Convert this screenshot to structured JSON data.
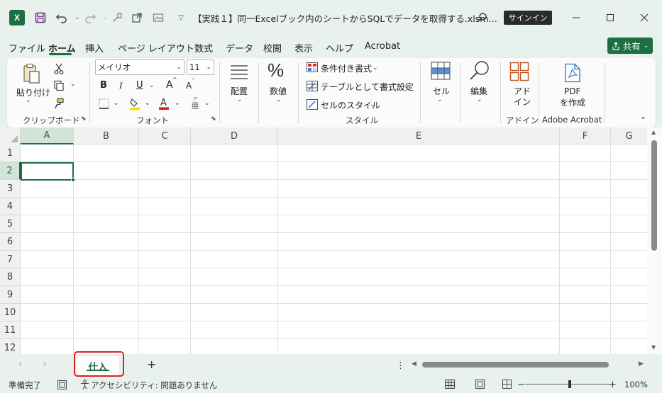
{
  "app": {
    "logo": "X",
    "doc_title": "【実践１】同一Excelブック内のシートからSQLでデータを取得する.xlsm…",
    "signin_label": "サインイン",
    "icons": {
      "save": "save-icon",
      "undo": "undo-icon",
      "redo": "redo-icon",
      "search": "search-icon"
    }
  },
  "menu": {
    "items": [
      "ファイル",
      "ホーム",
      "挿入",
      "ページ レイアウト",
      "数式",
      "データ",
      "校閲",
      "表示",
      "ヘルプ",
      "Acrobat"
    ],
    "active": "ホーム",
    "share_label": "共有"
  },
  "ribbon": {
    "clipboard": {
      "paste_label": "貼り付け",
      "group_label": "クリップボード"
    },
    "font": {
      "font_name": "メイリオ",
      "font_size": "11",
      "bold": "B",
      "italic": "I",
      "underline": "U",
      "grow": "A",
      "shrink": "A",
      "group_label": "フォント"
    },
    "alignment": {
      "label": "配置"
    },
    "number": {
      "symbol": "%",
      "label": "数値"
    },
    "styles": {
      "conditional": "条件付き書式",
      "table": "テーブルとして書式設定",
      "cell_styles": "セルのスタイル",
      "group_label": "スタイル"
    },
    "cells": {
      "label": "セル"
    },
    "editing": {
      "label": "編集"
    },
    "addins": {
      "label_line1": "アド",
      "label_line2": "イン",
      "group_label": "アドイン"
    },
    "acrobat": {
      "label_line1": "PDF",
      "label_line2": "を作成",
      "group_label": "Adobe Acrobat"
    }
  },
  "grid": {
    "columns": [
      "A",
      "B",
      "C",
      "D",
      "E",
      "F",
      "G"
    ],
    "rows": [
      "1",
      "2",
      "3",
      "4",
      "5",
      "6",
      "7",
      "8",
      "9",
      "10",
      "11",
      "12"
    ],
    "active_cell": "A2"
  },
  "sheets": {
    "tabs": [
      "仕入"
    ],
    "active": "仕入",
    "add_label": "+"
  },
  "status": {
    "ready": "準備完了",
    "accessibility": "アクセシビリティ: 問題ありません",
    "zoom": "100%",
    "zoom_minus": "−",
    "zoom_plus": "+"
  },
  "colors": {
    "accent": "#1d6f42",
    "highlight_border": "#e02020",
    "background": "#e8f1ec"
  }
}
